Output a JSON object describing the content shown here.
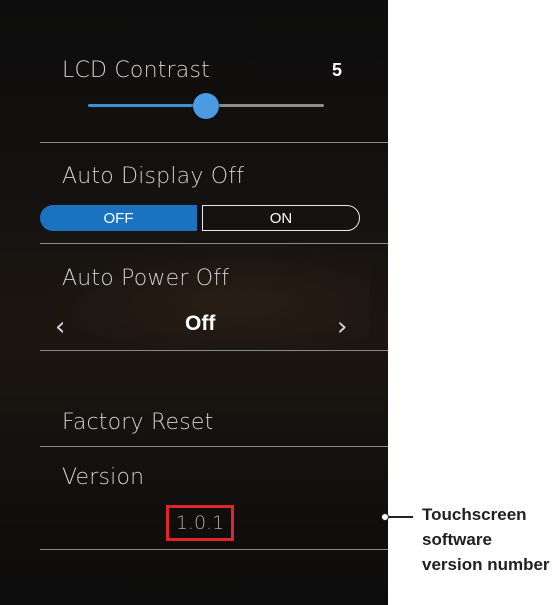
{
  "lcd_contrast": {
    "label": "LCD Contrast",
    "value": "5",
    "slider_level": 0.5
  },
  "auto_display_off": {
    "label": "Auto Display Off",
    "off_label": "OFF",
    "on_label": "ON",
    "selected": "OFF"
  },
  "auto_power_off": {
    "label": "Auto Power Off",
    "value": "Off",
    "prev_glyph": "‹",
    "next_glyph": "›"
  },
  "factory_reset": {
    "label": "Factory Reset"
  },
  "version": {
    "label": "Version",
    "value": "1.0.1"
  },
  "annotation": {
    "text": "Touchscreen software version number"
  },
  "colors": {
    "accent": "#1b72c1",
    "highlight": "#e0262a",
    "background": "#0d0d0d"
  }
}
